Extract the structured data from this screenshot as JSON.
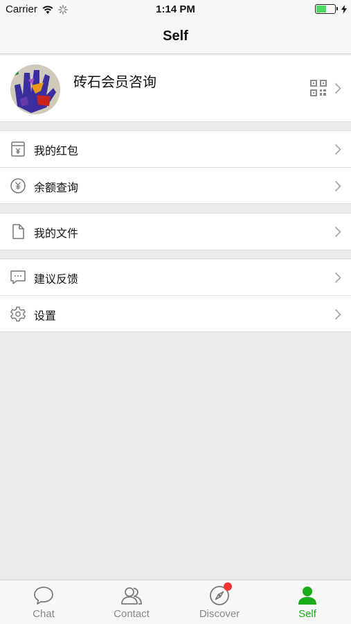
{
  "status_bar": {
    "carrier": "Carrier",
    "time": "1:14 PM",
    "battery_level": 0.55
  },
  "nav": {
    "title": "Self"
  },
  "profile": {
    "name": "砖石会员咨询"
  },
  "groups": [
    {
      "items": [
        {
          "icon": "red-packet-icon",
          "label": "我的红包"
        },
        {
          "icon": "yen-coin-icon",
          "label": "余额查询"
        }
      ]
    },
    {
      "items": [
        {
          "icon": "file-icon",
          "label": "我的文件"
        }
      ]
    },
    {
      "items": [
        {
          "icon": "chat-bubble-icon",
          "label": "建议反馈"
        },
        {
          "icon": "gear-icon",
          "label": "设置"
        }
      ]
    }
  ],
  "tabs": [
    {
      "label": "Chat",
      "icon": "chat-icon",
      "active": false
    },
    {
      "label": "Contact",
      "icon": "contacts-icon",
      "active": false
    },
    {
      "label": "Discover",
      "icon": "compass-icon",
      "active": false,
      "badge": true
    },
    {
      "label": "Self",
      "icon": "person-icon",
      "active": true
    }
  ],
  "colors": {
    "accent": "#1aad19",
    "badge": "#f43530",
    "battery": "#4cd964"
  }
}
